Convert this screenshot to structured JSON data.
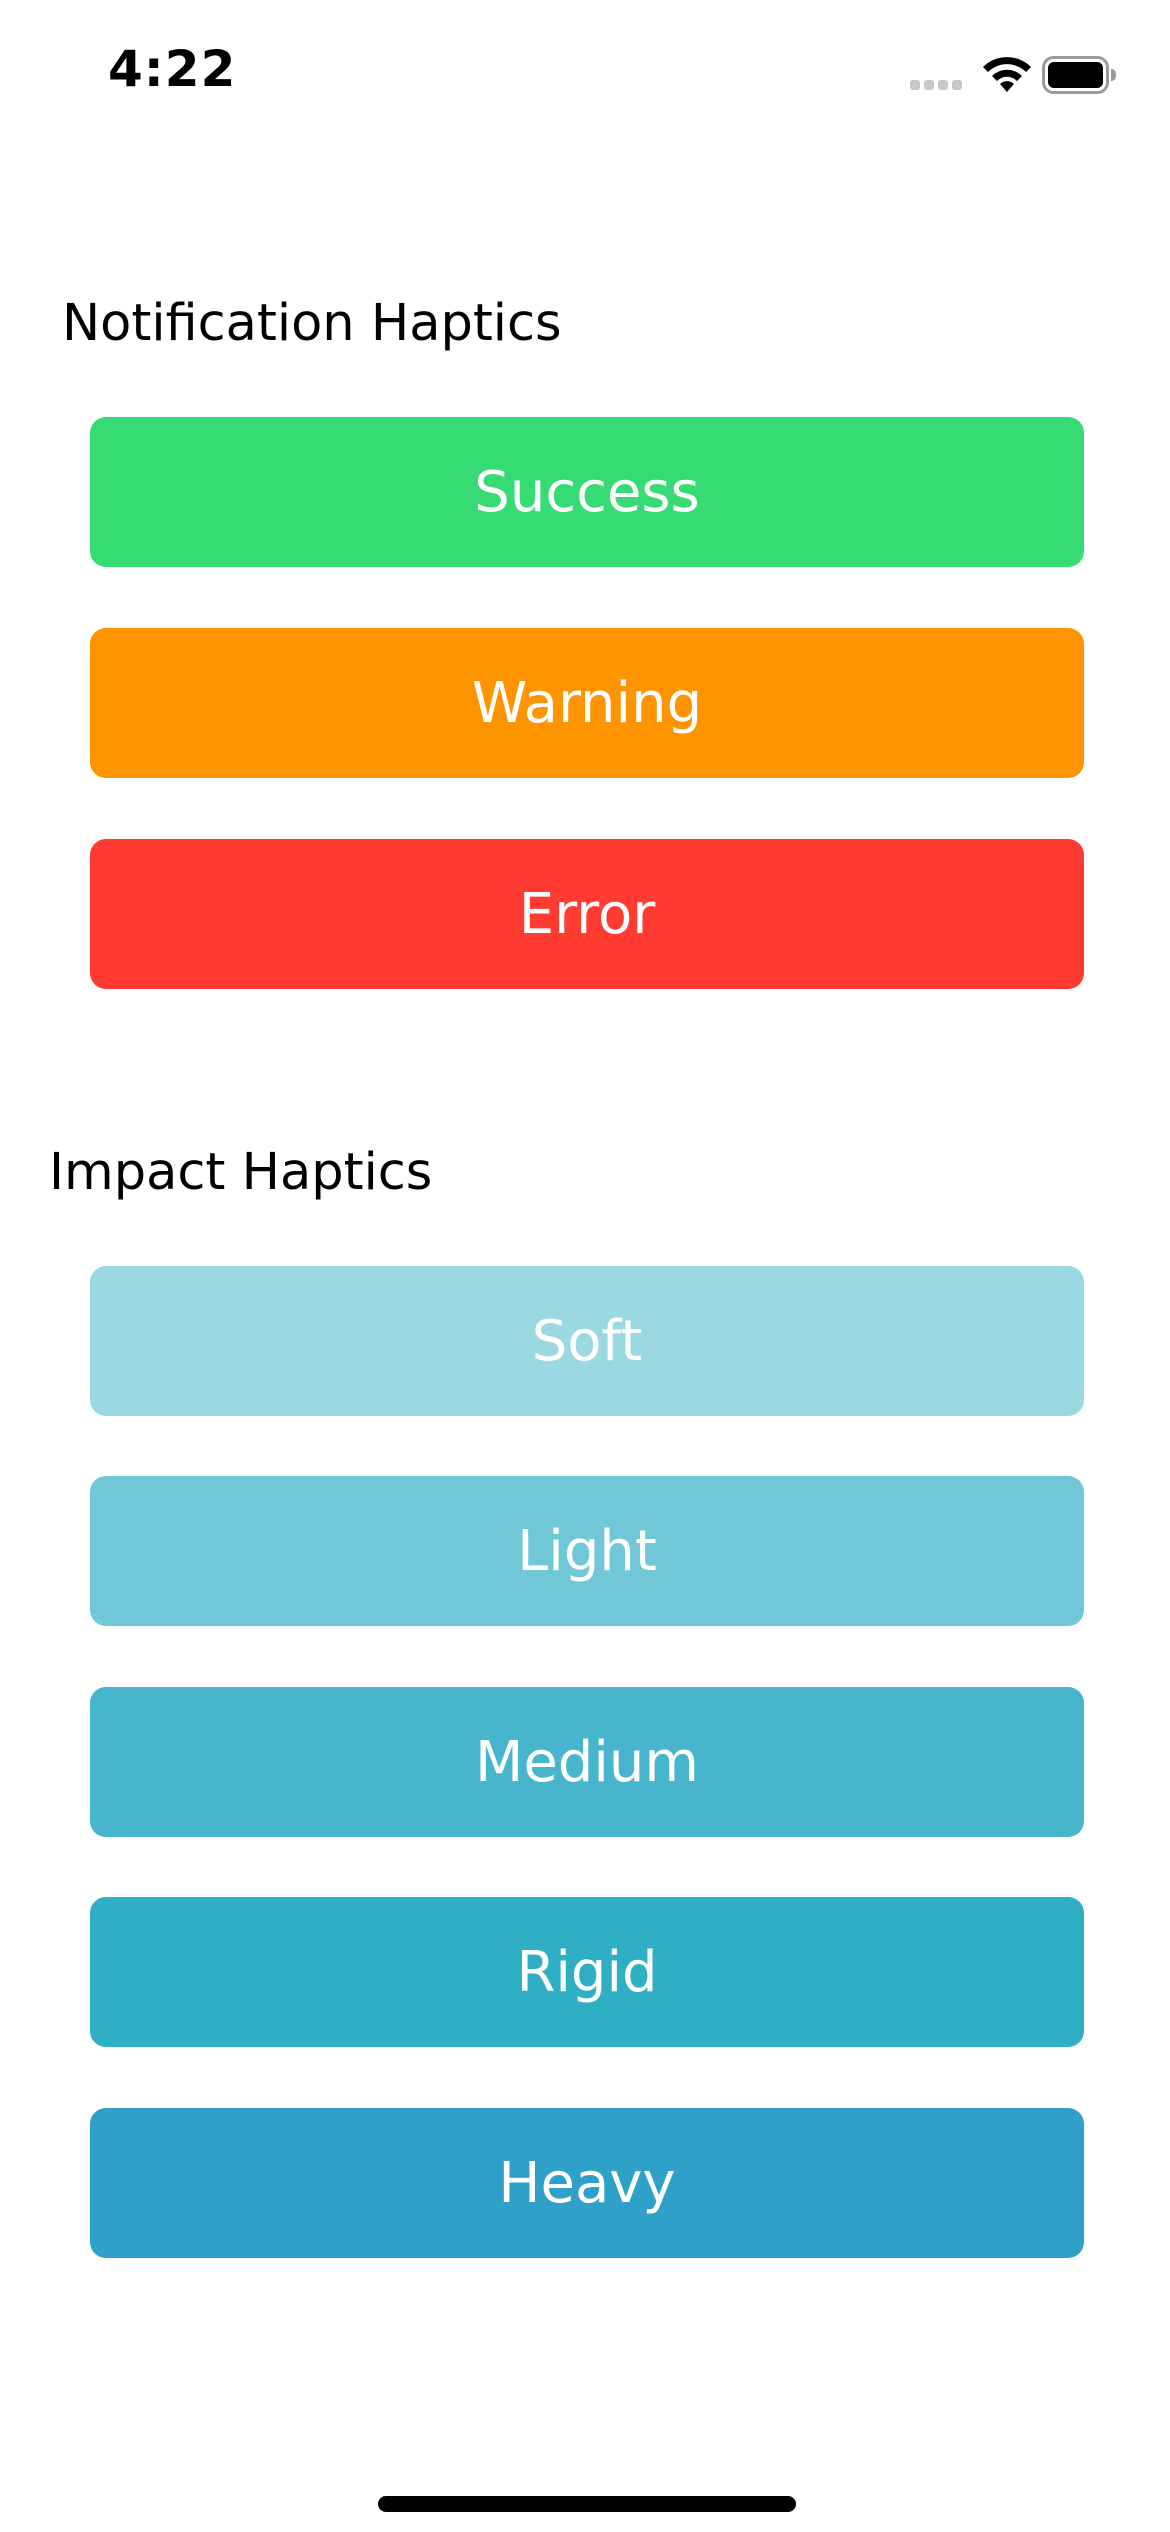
{
  "status_bar": {
    "time": "4:22",
    "icons": [
      "cellular-signal-icon",
      "wifi-icon",
      "battery-icon"
    ]
  },
  "notification_section": {
    "title": "Notification Haptics",
    "buttons": [
      {
        "label": "Success",
        "color": "#37DB74"
      },
      {
        "label": "Warning",
        "color": "#FE9400"
      },
      {
        "label": "Error",
        "color": "#FF3B32"
      }
    ]
  },
  "impact_section": {
    "title": "Impact Haptics",
    "buttons": [
      {
        "label": "Soft",
        "color": "#9AD8E2"
      },
      {
        "label": "Light",
        "color": "#6FC7D7"
      },
      {
        "label": "Medium",
        "color": "#47B6CC"
      },
      {
        "label": "Rigid",
        "color": "#2EAFC4"
      },
      {
        "label": "Heavy",
        "color": "#2FA1C8"
      }
    ]
  },
  "colors": {
    "background": "#FFFFFF",
    "text": "#000000",
    "button_text": "#FFFFFF"
  }
}
